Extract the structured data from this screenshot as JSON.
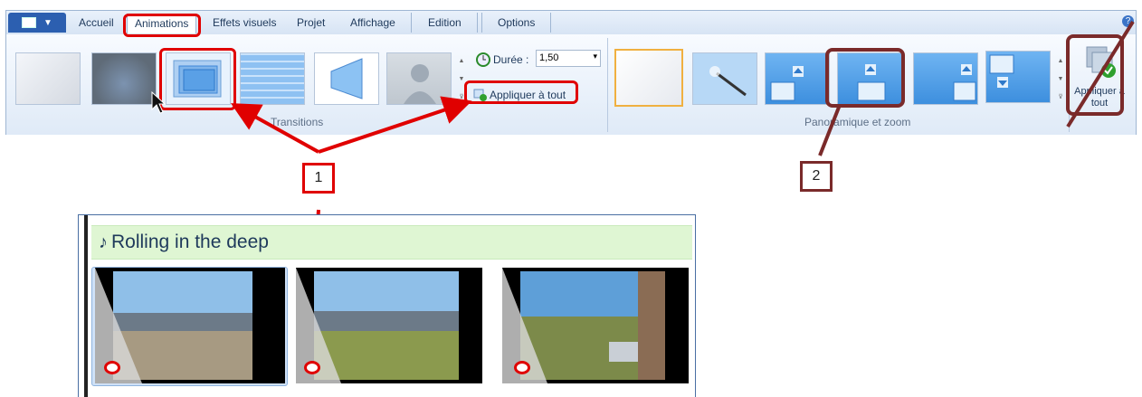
{
  "ribbon": {
    "tabs": [
      "Accueil",
      "Animations",
      "Effets visuels",
      "Projet",
      "Affichage",
      "Edition",
      "Options"
    ],
    "active_tab": "Animations",
    "help_icon": "?",
    "transitions": {
      "group_label": "Transitions",
      "duration_label": "Durée :",
      "duration_value": "1,50",
      "apply_all_label": "Appliquer à tout"
    },
    "panzoom": {
      "group_label": "Panoramique et zoom",
      "apply_all_label": "Appliquer à tout"
    }
  },
  "annotations": {
    "label_1": "1",
    "label_2": "2",
    "accent_red": "#e00000",
    "accent_maroon": "#7a2a2a"
  },
  "timeline": {
    "music_title": "Rolling in the deep",
    "music_icon": "♪",
    "clips": 3
  }
}
